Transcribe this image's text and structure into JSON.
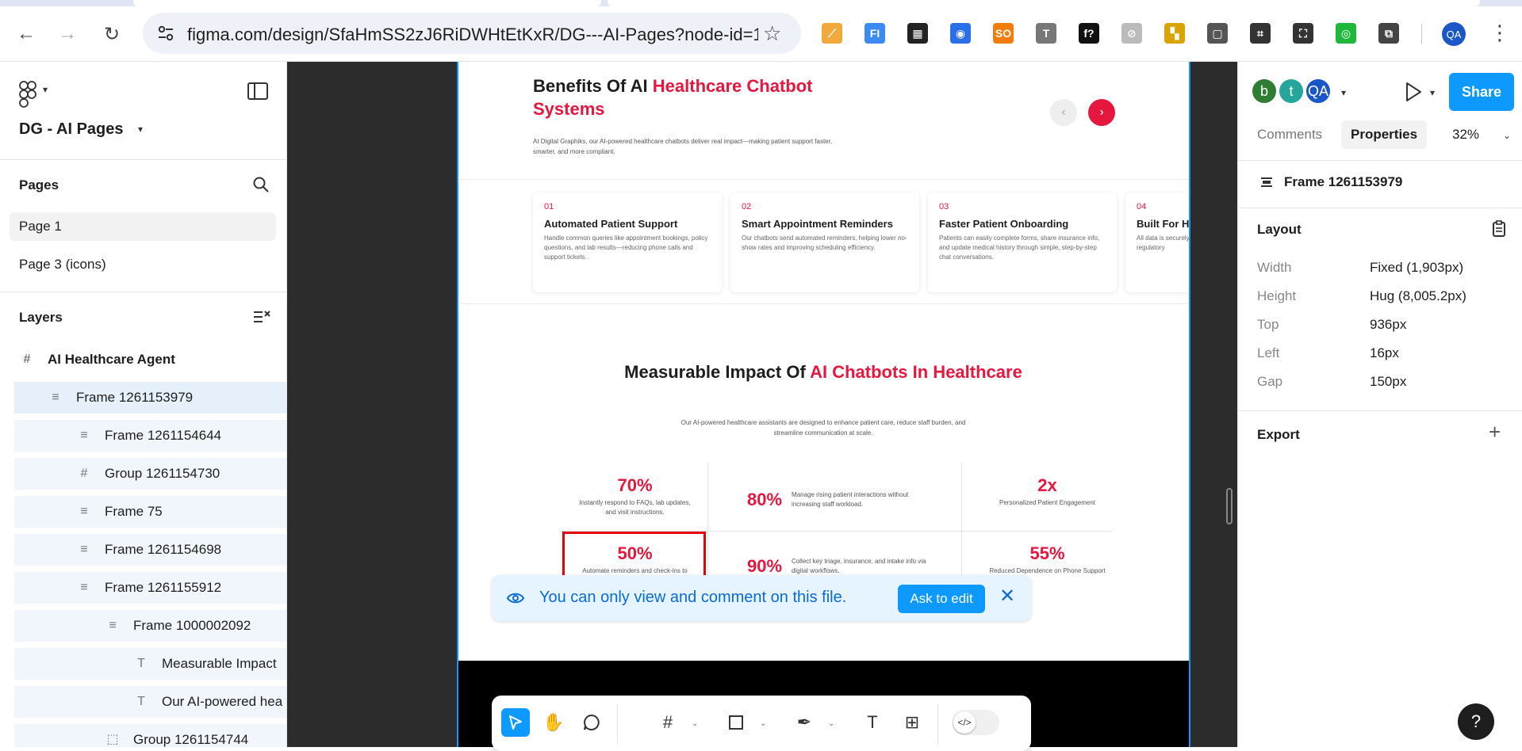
{
  "browser": {
    "url": "figma.com/design/SfaHmSS2zJ6RiDWHtEtKxR/DG---AI-Pages?node-id=16...",
    "profile_initials": "QA",
    "extensions": [
      {
        "name": "extension-1-icon",
        "color": "#f2a93b",
        "glyph": "⟋"
      },
      {
        "name": "extension-fi-icon",
        "color": "#3b8bf2",
        "glyph": "FI"
      },
      {
        "name": "qr-code-icon",
        "color": "#222222",
        "glyph": "▦"
      },
      {
        "name": "record-icon",
        "color": "#2a6ee8",
        "glyph": "◉"
      },
      {
        "name": "extension-so-icon",
        "color": "#f07d0c",
        "glyph": "SO"
      },
      {
        "name": "text-tool-icon",
        "color": "#777777",
        "glyph": "T"
      },
      {
        "name": "font-icon",
        "color": "#111111",
        "glyph": "f?"
      },
      {
        "name": "compass-icon",
        "color": "#bbbbbb",
        "glyph": "⊘"
      },
      {
        "name": "extension-color-icon",
        "color": "#d9a400",
        "glyph": "▚"
      },
      {
        "name": "window-icon",
        "color": "#555555",
        "glyph": "▢"
      },
      {
        "name": "grid-icon",
        "color": "#333333",
        "glyph": "⌗"
      },
      {
        "name": "screenshot-icon",
        "color": "#333333",
        "glyph": "⛶"
      },
      {
        "name": "eye-slash-icon",
        "color": "#1fb83a",
        "glyph": "◎"
      },
      {
        "name": "puzzle-icon",
        "color": "#444444",
        "glyph": "⧉"
      }
    ]
  },
  "left_panel": {
    "file_name": "DG - AI Pages",
    "pages_title": "Pages",
    "pages": [
      {
        "label": "Page 1",
        "selected": true
      },
      {
        "label": "Page 3 (icons)",
        "selected": false
      }
    ],
    "layers_title": "Layers",
    "layers": [
      {
        "label": "AI Healthcare Agent",
        "icon": "#",
        "indent": 0,
        "bold": true,
        "state": "normal"
      },
      {
        "label": "Frame 1261153979",
        "icon": "≡",
        "indent": 1,
        "bold": false,
        "state": "selected"
      },
      {
        "label": "Frame 1261154644",
        "icon": "≡",
        "indent": 2,
        "bold": false,
        "state": "tinted"
      },
      {
        "label": "Group 1261154730",
        "icon": "#",
        "indent": 2,
        "bold": false,
        "state": "tinted"
      },
      {
        "label": "Frame 75",
        "icon": "≡",
        "indent": 2,
        "bold": false,
        "state": "tinted"
      },
      {
        "label": "Frame 1261154698",
        "icon": "≡",
        "indent": 2,
        "bold": false,
        "state": "tinted"
      },
      {
        "label": "Frame 1261155912",
        "icon": "≡",
        "indent": 2,
        "bold": false,
        "state": "tinted"
      },
      {
        "label": "Frame 1000002092",
        "icon": "≡",
        "indent": 3,
        "bold": false,
        "state": "tinted"
      },
      {
        "label": "Measurable Impact",
        "icon": "T",
        "indent": 4,
        "bold": false,
        "state": "tinted"
      },
      {
        "label": "Our AI-powered hea",
        "icon": "T",
        "indent": 4,
        "bold": false,
        "state": "tinted"
      },
      {
        "label": "Group 1261154744",
        "icon": "⬚",
        "indent": 3,
        "bold": false,
        "state": "tinted"
      }
    ]
  },
  "design": {
    "benefits_title_plain": "Benefits Of AI ",
    "benefits_title_red": "Healthcare Chatbot Systems",
    "benefits_desc": "At Digital Graphiks, our AI-powered healthcare chatbots deliver real impact—making patient support faster, smarter, and more compliant.",
    "cards": [
      {
        "num": "01",
        "title": "Automated Patient Support",
        "desc": "Handle common queries like appointment bookings, policy questions, and lab results—reducing phone calls and support tickets."
      },
      {
        "num": "02",
        "title": "Smart Appointment Reminders",
        "desc": "Our chatbots send automated reminders, helping lower no-show rates and improving scheduling efficiency."
      },
      {
        "num": "03",
        "title": "Faster Patient Onboarding",
        "desc": "Patients can easily complete forms, share insurance info, and update medical history through simple, step-by-step chat conversations."
      },
      {
        "num": "04",
        "title": "Built For Healthcare",
        "desc": "All data is securely recorded with ensure full HIPAA and regulatory"
      }
    ],
    "impact_title_plain": "Measurable Impact Of ",
    "impact_title_red": "AI Chatbots In Healthcare",
    "impact_desc": "Our AI-powered healthcare assistants are designed to enhance patient care, reduce staff burden, and streamline communication at scale.",
    "stats": {
      "s1": {
        "value": "70%",
        "label": "Instantly respond to FAQs, lab updates, and visit instructions."
      },
      "s2": {
        "value": "80%",
        "label": "Manage rising patient interactions without increasing staff workload."
      },
      "s3": {
        "value": "2x",
        "label": "Personalized Patient Engagement"
      },
      "s4": {
        "value": "50%",
        "label": "Automate reminders and check-ins to aid recovery."
      },
      "s5": {
        "value": "90%",
        "label": "Collect key triage, insurance, and intake info via digital workflows."
      },
      "s6": {
        "value": "55%",
        "label": "Reduced Dependence on Phone Support"
      }
    }
  },
  "banner": {
    "message": "You can only view and comment on this file.",
    "ask_label": "Ask to edit"
  },
  "right_panel": {
    "avatars": [
      {
        "letter": "b",
        "color": "#2e7d32"
      },
      {
        "letter": "t",
        "color": "#26a69a"
      },
      {
        "letter": "QA",
        "color": "#1a56c6"
      }
    ],
    "share_label": "Share",
    "tabs": {
      "comments": "Comments",
      "properties": "Properties"
    },
    "zoom": "32%",
    "selection_name": "Frame 1261153979",
    "layout_title": "Layout",
    "props": [
      {
        "label": "Width",
        "value": "Fixed (1,903px)"
      },
      {
        "label": "Height",
        "value": "Hug (8,005.2px)"
      },
      {
        "label": "Top",
        "value": "936px"
      },
      {
        "label": "Left",
        "value": "16px"
      },
      {
        "label": "Gap",
        "value": "150px"
      }
    ],
    "export_title": "Export"
  },
  "colors": {
    "accent": "#0d99ff",
    "brand_red": "#e5173f"
  }
}
